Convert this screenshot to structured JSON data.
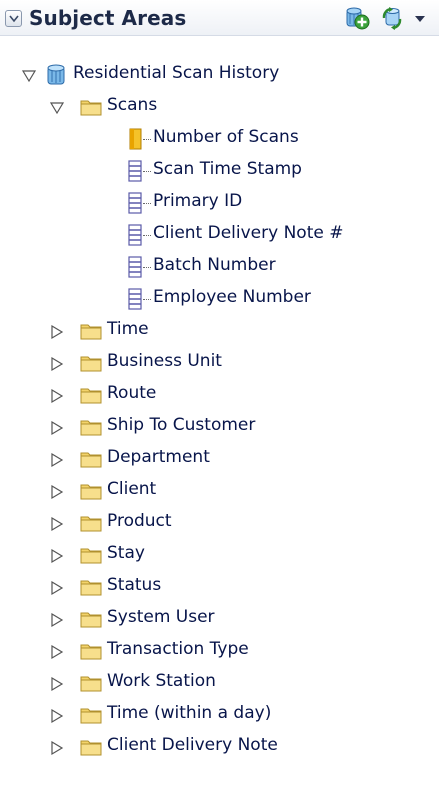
{
  "header": {
    "title": "Subject Areas",
    "collapse_icon": "chevron-down-icon",
    "add_icon": "add-subject-area-icon",
    "refresh_icon": "refresh-icon",
    "menu_icon": "dropdown-arrow-icon"
  },
  "tree": {
    "root": {
      "label": "Residential Scan History",
      "icon": "subject-area-cylinder-icon",
      "expanded": true
    },
    "scans": {
      "label": "Scans",
      "icon": "folder-icon",
      "expanded": true,
      "children": [
        {
          "label": "Number of Scans",
          "icon": "measure-column-icon"
        },
        {
          "label": "Scan Time Stamp",
          "icon": "attribute-column-icon"
        },
        {
          "label": "Primary ID",
          "icon": "attribute-column-icon"
        },
        {
          "label": "Client Delivery Note #",
          "icon": "attribute-column-icon"
        },
        {
          "label": "Batch Number",
          "icon": "attribute-column-icon"
        },
        {
          "label": "Employee Number",
          "icon": "attribute-column-icon"
        }
      ]
    },
    "folders": [
      {
        "label": "Time",
        "expanded": false
      },
      {
        "label": "Business Unit",
        "expanded": false
      },
      {
        "label": "Route",
        "expanded": false
      },
      {
        "label": "Ship To Customer",
        "expanded": false
      },
      {
        "label": "Department",
        "expanded": false
      },
      {
        "label": "Client",
        "expanded": false
      },
      {
        "label": "Product",
        "expanded": false
      },
      {
        "label": "Stay",
        "expanded": false
      },
      {
        "label": "Status",
        "expanded": false
      },
      {
        "label": "System User",
        "expanded": false
      },
      {
        "label": "Transaction Type",
        "expanded": false
      },
      {
        "label": "Work Station",
        "expanded": false
      },
      {
        "label": "Time (within a day)",
        "expanded": false
      },
      {
        "label": "Client Delivery Note",
        "expanded": false
      }
    ]
  },
  "colors": {
    "text": "#08154a",
    "folder": "#f3d36b",
    "measure": "#f0b400",
    "attribute": "#7b7bc4",
    "root_icon": "#3a8fd8"
  }
}
